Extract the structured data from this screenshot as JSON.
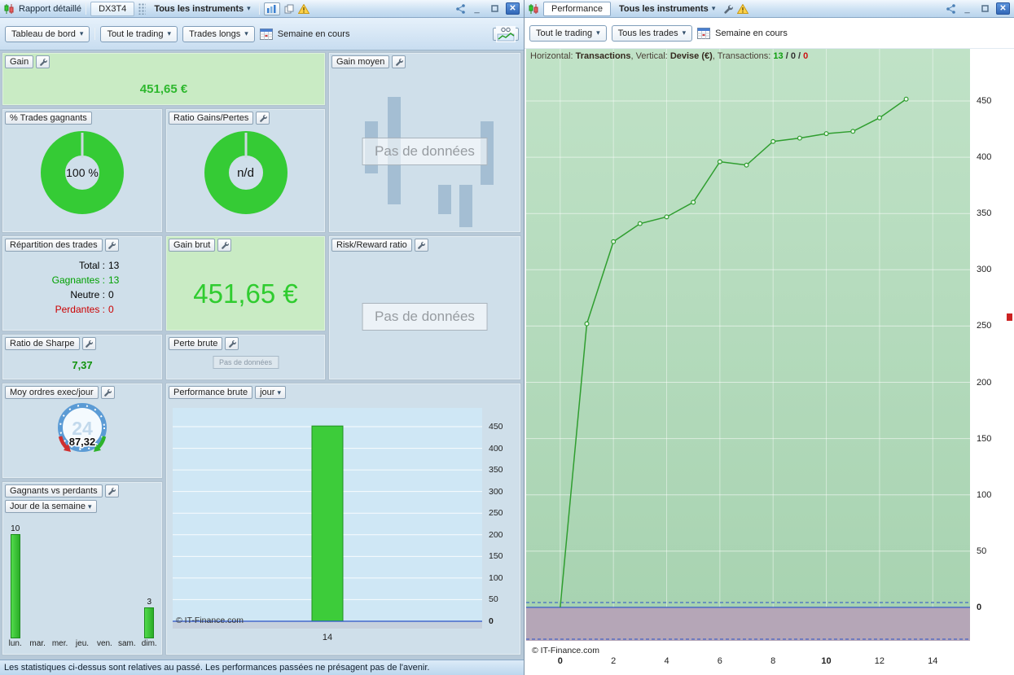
{
  "icons": {
    "caret": "▾",
    "close": "✕",
    "minimize": "_"
  },
  "colors": {
    "accent_green": "#33cc33",
    "win_green": "#00a000",
    "loss_red": "#cc0000",
    "zero_line_blue": "#2a52c8",
    "chart_positive_bg": "#b2d9ba",
    "chart_negative_bg": "#b5a6b7"
  },
  "left_panel": {
    "titlebar": {
      "title": "Rapport détaillé",
      "tab": "DX3T4",
      "instrument_selector": "Tous les instruments"
    },
    "toolbar": {
      "view_selector": "Tableau de bord",
      "trading_filter": "Tout le trading",
      "trades_filter": "Trades longs",
      "period_label": "Semaine en cours"
    },
    "cards": {
      "gain": {
        "label": "Gain",
        "value": "451,65 €"
      },
      "gain_moyen": {
        "label": "Gain moyen",
        "no_data": "Pas de données"
      },
      "pct_trades_gagnants": {
        "label": "% Trades gagnants",
        "value": "100 %"
      },
      "ratio_gains_pertes": {
        "label": "Ratio Gains/Pertes",
        "value": "n/d"
      },
      "repartition": {
        "label": "Répartition des trades",
        "rows": [
          {
            "name": "Total :",
            "value": "13",
            "color": "#000000"
          },
          {
            "name": "Gagnantes :",
            "value": "13",
            "color": "#00a000"
          },
          {
            "name": "Neutre :",
            "value": "0",
            "color": "#000000"
          },
          {
            "name": "Perdantes :",
            "value": "0",
            "color": "#cc0000"
          }
        ]
      },
      "gain_brut": {
        "label": "Gain brut",
        "value": "451,65 €"
      },
      "risk_reward": {
        "label": "Risk/Reward ratio",
        "no_data": "Pas de données"
      },
      "ratio_sharpe": {
        "label": "Ratio de Sharpe",
        "value": "7,37"
      },
      "perte_brute": {
        "label": "Perte brute",
        "no_data": "Pas de données"
      },
      "moy_ordres": {
        "label": "Moy ordres exec/jour",
        "value": "87,32",
        "gauge_center": "24"
      },
      "gagnants_perdants": {
        "label": "Gagnants vs perdants",
        "group_selector": "Jour de la semaine"
      },
      "performance_brute": {
        "label": "Performance brute",
        "period_selector": "jour"
      }
    },
    "status_bar": "Les statistiques ci-dessus sont relatives au passé. Les performances passées ne présagent pas de l'avenir.",
    "copyright": "© IT-Finance.com"
  },
  "right_panel": {
    "titlebar": {
      "tab": "Performance",
      "instrument_selector": "Tous les instruments"
    },
    "toolbar": {
      "trading_filter": "Tout le trading",
      "trades_filter": "Tous les trades",
      "period_label": "Semaine en cours"
    },
    "info_line": {
      "horizontal_label": "Horizontal:",
      "horizontal_value": "Transactions",
      "vertical_label": ", Vertical:",
      "vertical_value": "Devise (€)",
      "transactions_label": ", Transactions:",
      "wins": "13",
      "separator": "/",
      "neutral": "0",
      "losses": "0"
    },
    "copyright": "© IT-Finance.com"
  },
  "chart_data": [
    {
      "id": "performance_equity_curve",
      "type": "line",
      "title": "Performance",
      "xlabel": "Transactions",
      "ylabel": "Devise (€)",
      "x": [
        0,
        1,
        2,
        3,
        4,
        5,
        6,
        7,
        8,
        9,
        10,
        11,
        12,
        13
      ],
      "values": [
        0,
        252,
        325,
        341,
        347,
        360,
        396,
        393,
        414,
        417,
        421,
        423,
        435,
        451.65
      ],
      "xlim": [
        -1.28,
        15.4
      ],
      "ylim": [
        -29.7,
        496.3
      ],
      "x_ticks": [
        0,
        2,
        4,
        6,
        8,
        10,
        12,
        14
      ],
      "x_ticks_bold": [
        0,
        10
      ],
      "y_ticks": [
        450,
        400,
        350,
        300,
        250,
        200,
        150,
        100,
        50,
        0
      ],
      "y_ticks_bold": [
        0
      ],
      "grid": true,
      "line_color": "#2f9e2f",
      "marker": "circle"
    },
    {
      "id": "performance_brute_daily",
      "type": "bar",
      "title": "Performance brute (jour)",
      "categories": [
        "14"
      ],
      "values": [
        451.65
      ],
      "ylim": [
        -17,
        493.4
      ],
      "y_ticks": [
        450,
        400,
        350,
        300,
        250,
        200,
        150,
        100,
        50,
        0
      ],
      "y_ticks_bold": [
        0
      ],
      "grid": true,
      "bar_color": "#3dcc3a"
    },
    {
      "id": "gagnants_vs_perdants_weekday",
      "type": "bar",
      "title": "Gagnants vs perdants (Jour de la semaine)",
      "categories": [
        "lun.",
        "mar.",
        "mer.",
        "jeu.",
        "ven.",
        "sam.",
        "dim."
      ],
      "values": [
        10,
        0,
        0,
        0,
        0,
        0,
        3
      ],
      "ylim": [
        0,
        11
      ],
      "grid": false,
      "data_labels": true,
      "bar_color": "#3dcc3a"
    }
  ]
}
